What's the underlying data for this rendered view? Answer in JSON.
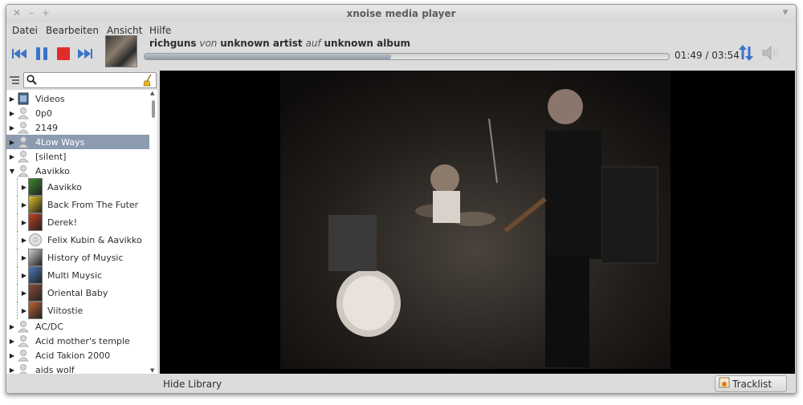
{
  "window": {
    "title": "xnoise media player"
  },
  "menu": [
    "Datei",
    "Bearbeiten",
    "Ansicht",
    "Hilfe"
  ],
  "now_playing": {
    "title": "richguns",
    "by_word": "von",
    "artist": "unknown artist",
    "on_word": "auf",
    "album": "unknown album",
    "elapsed": "01:49",
    "duration": "03:54",
    "time_text": "01:49 / 03:54",
    "progress_fraction": 0.47
  },
  "search": {
    "value": "",
    "placeholder": ""
  },
  "library": {
    "items": [
      {
        "label": "Videos",
        "type": "videos",
        "expanded": false
      },
      {
        "label": "0p0",
        "type": "artist",
        "expanded": false
      },
      {
        "label": "2149",
        "type": "artist",
        "expanded": false
      },
      {
        "label": "4Low Ways",
        "type": "artist",
        "expanded": false,
        "selected": true
      },
      {
        "label": "[silent]",
        "type": "artist",
        "expanded": false
      },
      {
        "label": "Aavikko",
        "type": "artist",
        "expanded": true
      },
      {
        "label": "Aavikko",
        "type": "album",
        "indent": true
      },
      {
        "label": "Back From The Futer",
        "type": "album",
        "indent": true
      },
      {
        "label": "Derek!",
        "type": "album",
        "indent": true
      },
      {
        "label": "Felix Kubin & Aavikko",
        "type": "album-cd",
        "indent": true
      },
      {
        "label": "History of Muysic",
        "type": "album",
        "indent": true
      },
      {
        "label": "Multi Muysic",
        "type": "album",
        "indent": true
      },
      {
        "label": "Oriental Baby",
        "type": "album",
        "indent": true
      },
      {
        "label": "Viitostie",
        "type": "album",
        "indent": true
      },
      {
        "label": "AC/DC",
        "type": "artist",
        "expanded": false
      },
      {
        "label": "Acid mother's temple",
        "type": "artist",
        "expanded": false
      },
      {
        "label": "Acid Takion 2000",
        "type": "artist",
        "expanded": false
      },
      {
        "label": "aids wolf",
        "type": "artist",
        "expanded": false
      }
    ]
  },
  "footer": {
    "hide_library": "Hide Library",
    "tracklist": "Tracklist"
  },
  "colors": {
    "accent": "#3a74c9",
    "stop": "#e22b2b",
    "selection": "#8c9bb0"
  }
}
